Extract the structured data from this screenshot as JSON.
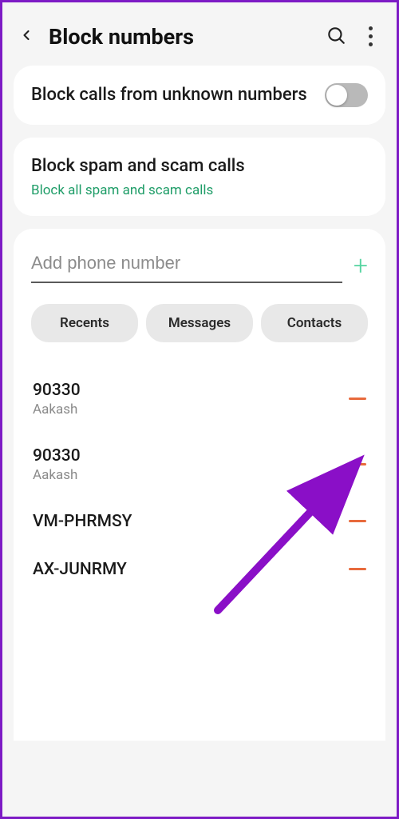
{
  "header": {
    "title": "Block numbers"
  },
  "unknown_card": {
    "title": "Block calls from unknown numbers",
    "toggle_on": false
  },
  "spam_card": {
    "title": "Block spam and scam calls",
    "subtitle": "Block all spam and scam calls"
  },
  "add_input": {
    "placeholder": "Add phone number",
    "value": ""
  },
  "tabs": {
    "recents": "Recents",
    "messages": "Messages",
    "contacts": "Contacts"
  },
  "blocked": [
    {
      "number": "90330",
      "name": "Aakash"
    },
    {
      "number": "90330",
      "name": "Aakash"
    },
    {
      "number": "VM-PHRMSY",
      "name": ""
    },
    {
      "number": "AX-JUNRMY",
      "name": ""
    }
  ]
}
